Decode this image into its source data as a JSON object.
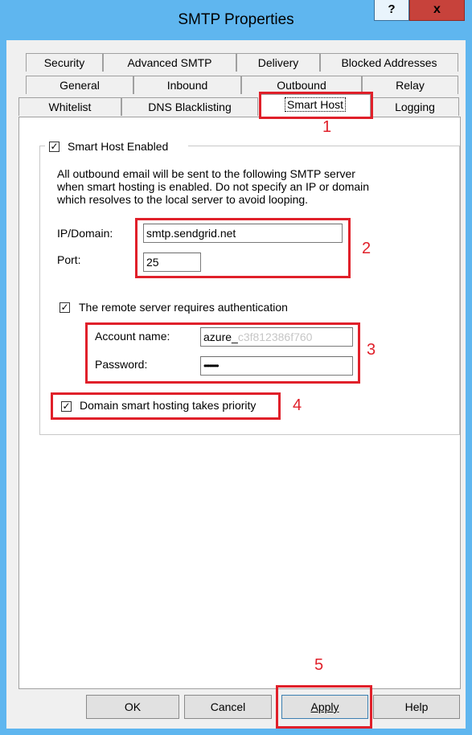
{
  "window": {
    "title": "SMTP Properties",
    "help_glyph": "?",
    "close_glyph": "x"
  },
  "tabs": {
    "row1": [
      "Security",
      "Advanced SMTP",
      "Delivery",
      "Blocked Addresses"
    ],
    "row2": [
      "General",
      "Inbound",
      "Outbound",
      "Relay"
    ],
    "row3": [
      "Whitelist",
      "DNS Blacklisting",
      "Smart Host",
      "Logging"
    ],
    "active": "Smart Host"
  },
  "smart_host": {
    "enabled_label": "Smart Host Enabled",
    "enabled": true,
    "description": [
      "All outbound email will be sent to the following SMTP server",
      "when smart hosting is enabled. Do not specify an IP or domain",
      "which resolves to the local server to avoid looping."
    ],
    "ip_label": "IP/Domain:",
    "ip_value": "smtp.sendgrid.net",
    "port_label": "Port:",
    "port_value": "25",
    "auth_label": "The remote server requires authentication",
    "auth_checked": true,
    "account_label": "Account name:",
    "account_value_visible": "azure_",
    "account_value_faded": "c3f812386f760",
    "password_label": "Password:",
    "password_value": "••••••••",
    "priority_label": "Domain smart hosting takes priority",
    "priority_checked": true
  },
  "annotations": [
    "1",
    "2",
    "3",
    "4",
    "5"
  ],
  "buttons": {
    "ok": "OK",
    "cancel": "Cancel",
    "apply": "Apply",
    "help": "Help"
  },
  "check_glyph": "✓"
}
